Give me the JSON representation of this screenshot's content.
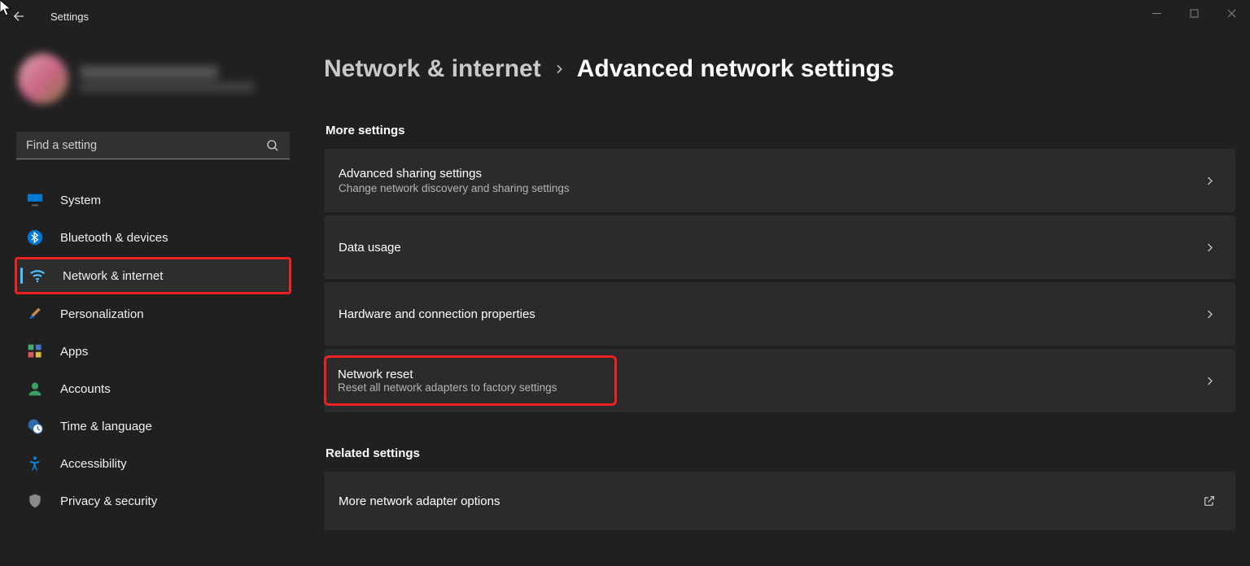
{
  "window": {
    "title": "Settings"
  },
  "search": {
    "placeholder": "Find a setting"
  },
  "sidebar": {
    "items": [
      {
        "label": "System",
        "icon": "monitor-icon"
      },
      {
        "label": "Bluetooth & devices",
        "icon": "bluetooth-icon"
      },
      {
        "label": "Network & internet",
        "icon": "wifi-icon",
        "active": true,
        "highlight": true
      },
      {
        "label": "Personalization",
        "icon": "paintbrush-icon"
      },
      {
        "label": "Apps",
        "icon": "apps-icon"
      },
      {
        "label": "Accounts",
        "icon": "person-icon"
      },
      {
        "label": "Time & language",
        "icon": "clock-globe-icon"
      },
      {
        "label": "Accessibility",
        "icon": "accessibility-icon"
      },
      {
        "label": "Privacy & security",
        "icon": "shield-icon"
      }
    ]
  },
  "breadcrumb": {
    "parent": "Network & internet",
    "current": "Advanced network settings"
  },
  "sections": {
    "more_settings_label": "More settings",
    "related_settings_label": "Related settings"
  },
  "cards": {
    "sharing": {
      "title": "Advanced sharing settings",
      "subtitle": "Change network discovery and sharing settings"
    },
    "data": {
      "title": "Data usage"
    },
    "hardware": {
      "title": "Hardware and connection properties"
    },
    "reset": {
      "title": "Network reset",
      "subtitle": "Reset all network adapters to factory settings",
      "highlight": true
    },
    "adapter": {
      "title": "More network adapter options"
    }
  }
}
